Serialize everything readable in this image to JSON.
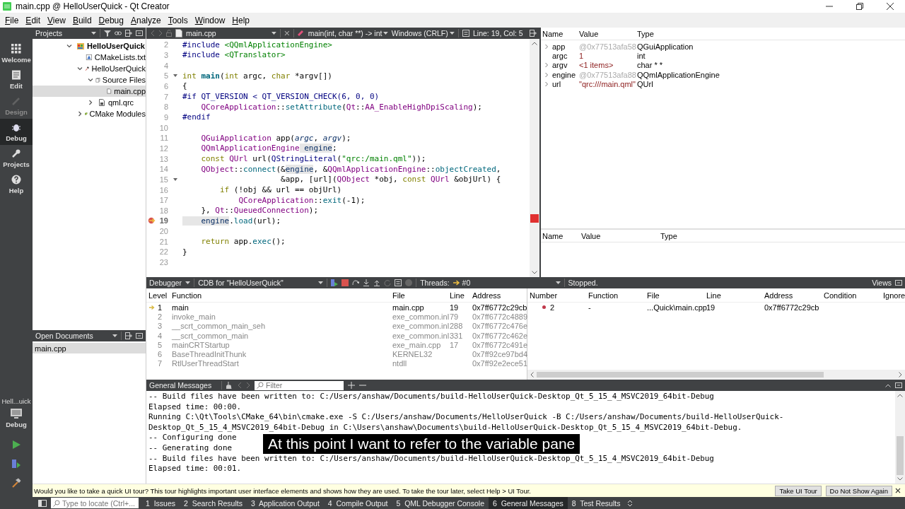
{
  "window": {
    "title": "main.cpp @ HelloUserQuick - Qt Creator"
  },
  "menu": [
    "File",
    "Edit",
    "View",
    "Build",
    "Debug",
    "Analyze",
    "Tools",
    "Window",
    "Help"
  ],
  "modes": [
    {
      "label": "Welcome",
      "selected": false,
      "disabled": false
    },
    {
      "label": "Edit",
      "selected": false,
      "disabled": false
    },
    {
      "label": "Design",
      "selected": false,
      "disabled": true
    },
    {
      "label": "Debug",
      "selected": true,
      "disabled": false
    },
    {
      "label": "Projects",
      "selected": false,
      "disabled": false
    },
    {
      "label": "Help",
      "selected": false,
      "disabled": false
    }
  ],
  "kit": {
    "project": "Hell...uick",
    "build": "Debug"
  },
  "projects": {
    "title": "Projects",
    "tree": [
      {
        "label": "HelloUserQuick",
        "kind": "project",
        "expanded": true,
        "selected": false,
        "children": [
          {
            "label": "CMakeLists.txt",
            "kind": "cmake",
            "selected": false
          },
          {
            "label": "HelloUserQuick",
            "kind": "target",
            "expanded": true,
            "selected": false,
            "children": [
              {
                "label": "Source Files",
                "kind": "folder",
                "expanded": true,
                "selected": false,
                "children": [
                  {
                    "label": "main.cpp",
                    "kind": "file",
                    "selected": true
                  }
                ]
              },
              {
                "label": "qml.qrc",
                "kind": "resource",
                "expanded": false,
                "selected": false
              }
            ]
          },
          {
            "label": "CMake Modules",
            "kind": "modules",
            "expanded": false,
            "selected": false
          }
        ]
      }
    ]
  },
  "open_documents": {
    "title": "Open Documents",
    "items": [
      {
        "label": "main.cpp",
        "selected": true
      }
    ]
  },
  "editor": {
    "file": "main.cpp",
    "symbol": "main(int, char **) -> int",
    "line_ending": "Windows (CRLF)",
    "position": "Line: 19, Col: 5",
    "lines": [
      {
        "n": "2",
        "tokens": [
          {
            "text": "#include ",
            "kind": "pp"
          },
          {
            "text": "<QQmlApplicationEngine>",
            "kind": "str"
          }
        ]
      },
      {
        "n": "3",
        "tokens": [
          {
            "text": "#include ",
            "kind": "pp"
          },
          {
            "text": "<QTranslator>",
            "kind": "str"
          }
        ]
      },
      {
        "n": "4"
      },
      {
        "n": "5",
        "fold": true,
        "tokens": [
          {
            "text": "int ",
            "kind": "kw"
          },
          {
            "text": "main",
            "kind": "fn"
          },
          {
            "text": "(",
            "kind": "plain"
          },
          {
            "text": "int",
            "kind": "kw"
          },
          {
            "text": " argc, ",
            "kind": "plain"
          },
          {
            "text": "char",
            "kind": "kw"
          },
          {
            "text": " *argv[])",
            "kind": "plain"
          }
        ]
      },
      {
        "n": "6",
        "tokens": [
          {
            "text": "{",
            "kind": "plain"
          }
        ]
      },
      {
        "n": "7",
        "tokens": [
          {
            "text": "#if QT_VERSION < QT_VERSION_CHECK(6, 0, 0)",
            "kind": "pp"
          }
        ]
      },
      {
        "n": "8",
        "tokens": [
          {
            "text": "    QCoreApplication",
            "kind": "type"
          },
          {
            "text": "::",
            "kind": "plain"
          },
          {
            "text": "setAttribute",
            "kind": "call"
          },
          {
            "text": "(",
            "kind": "plain"
          },
          {
            "text": "Qt",
            "kind": "type"
          },
          {
            "text": "::",
            "kind": "plain"
          },
          {
            "text": "AA_EnableHighDpiScaling",
            "kind": "enum"
          },
          {
            "text": ");",
            "kind": "plain"
          }
        ]
      },
      {
        "n": "9",
        "tokens": [
          {
            "text": "#endif",
            "kind": "pp"
          }
        ]
      },
      {
        "n": "10"
      },
      {
        "n": "11",
        "tokens": [
          {
            "text": "    QGuiApplication",
            "kind": "type"
          },
          {
            "text": " app(",
            "kind": "plain"
          },
          {
            "text": "argc",
            "kind": "param"
          },
          {
            "text": ", ",
            "kind": "plain"
          },
          {
            "text": "argv",
            "kind": "param"
          },
          {
            "text": ");",
            "kind": "plain"
          }
        ]
      },
      {
        "n": "12",
        "tokens": [
          {
            "text": "    QQmlApplicationEngine",
            "kind": "type"
          },
          {
            "text": " engine",
            "kind": "highlight"
          },
          {
            "text": ";",
            "kind": "plain"
          }
        ]
      },
      {
        "n": "13",
        "tokens": [
          {
            "text": "    const",
            "kind": "kw"
          },
          {
            "text": " QUrl",
            "kind": "type"
          },
          {
            "text": " url(",
            "kind": "plain"
          },
          {
            "text": "QStringLiteral",
            "kind": "pp"
          },
          {
            "text": "(",
            "kind": "plain"
          },
          {
            "text": "\"qrc:/main.qml\"",
            "kind": "str"
          },
          {
            "text": "));",
            "kind": "plain"
          }
        ]
      },
      {
        "n": "14",
        "tokens": [
          {
            "text": "    QObject",
            "kind": "type"
          },
          {
            "text": "::",
            "kind": "plain"
          },
          {
            "text": "connect",
            "kind": "call"
          },
          {
            "text": "(&",
            "kind": "plain"
          },
          {
            "text": "engine",
            "kind": "highlight"
          },
          {
            "text": ", &",
            "kind": "plain"
          },
          {
            "text": "QQmlApplicationEngine",
            "kind": "type"
          },
          {
            "text": "::",
            "kind": "plain"
          },
          {
            "text": "objectCreated",
            "kind": "call"
          },
          {
            "text": ",",
            "kind": "plain"
          }
        ]
      },
      {
        "n": "15",
        "fold": true,
        "tokens": [
          {
            "text": "                     &app, [url](",
            "kind": "plain"
          },
          {
            "text": "QObject",
            "kind": "type"
          },
          {
            "text": " *obj, ",
            "kind": "plain"
          },
          {
            "text": "const",
            "kind": "kw"
          },
          {
            "text": " QUrl",
            "kind": "type"
          },
          {
            "text": " &objUrl) {",
            "kind": "plain"
          }
        ]
      },
      {
        "n": "16",
        "tokens": [
          {
            "text": "        if",
            "kind": "kw"
          },
          {
            "text": " (!obj && url == objUrl)",
            "kind": "plain"
          }
        ]
      },
      {
        "n": "17",
        "tokens": [
          {
            "text": "            QCoreApplication",
            "kind": "type"
          },
          {
            "text": "::",
            "kind": "plain"
          },
          {
            "text": "exit",
            "kind": "call"
          },
          {
            "text": "(-1);",
            "kind": "plain"
          }
        ]
      },
      {
        "n": "18",
        "tokens": [
          {
            "text": "    }, ",
            "kind": "plain"
          },
          {
            "text": "Qt",
            "kind": "type"
          },
          {
            "text": "::",
            "kind": "plain"
          },
          {
            "text": "QueuedConnection",
            "kind": "enum"
          },
          {
            "text": ");",
            "kind": "plain"
          }
        ]
      },
      {
        "n": "19",
        "breakpoint": true,
        "current": true,
        "tokens": [
          {
            "text": "    engine",
            "kind": "highlight"
          },
          {
            "text": ".",
            "kind": "plain"
          },
          {
            "text": "load",
            "kind": "call"
          },
          {
            "text": "(url);",
            "kind": "plain"
          }
        ]
      },
      {
        "n": "20"
      },
      {
        "n": "21",
        "tokens": [
          {
            "text": "    return",
            "kind": "kw"
          },
          {
            "text": " app.",
            "kind": "plain"
          },
          {
            "text": "exec",
            "kind": "call"
          },
          {
            "text": "();",
            "kind": "plain"
          }
        ]
      },
      {
        "n": "22",
        "tokens": [
          {
            "text": "}",
            "kind": "plain"
          }
        ]
      },
      {
        "n": "23"
      }
    ]
  },
  "locals": {
    "columns": [
      "Name",
      "Value",
      "Type"
    ],
    "rows": [
      {
        "name": "app",
        "value": "@0x77513afa58",
        "type": "QGuiApplication",
        "expandable": true,
        "dim": true
      },
      {
        "name": "argc",
        "value": "1",
        "type": "int",
        "expandable": false,
        "dim": false
      },
      {
        "name": "argv",
        "value": "<1 items>",
        "type": "char * *",
        "expandable": true,
        "dim": false
      },
      {
        "name": "engine",
        "value": "@0x77513afa88",
        "type": "QQmlApplicationEngine",
        "expandable": true,
        "dim": true
      },
      {
        "name": "url",
        "value": "\"qrc:///main.qml\"",
        "type": "QUrl",
        "expandable": true,
        "dim": false
      }
    ]
  },
  "expressions": {
    "columns": [
      "Name",
      "Value",
      "Type"
    ]
  },
  "debugger_toolbar": {
    "view": "Debugger",
    "engine": "CDB for \"HelloUserQuick\"",
    "threads_label": "Threads:",
    "thread": "#0",
    "status": "Stopped.",
    "views": "Views"
  },
  "stack": {
    "columns": [
      "Level",
      "Function",
      "File",
      "Line",
      "Address"
    ],
    "rows": [
      {
        "level": "1",
        "function": "main",
        "file": "main.cpp",
        "line": "19",
        "address": "0x7ff6772c29cb",
        "current": true,
        "available": true
      },
      {
        "level": "2",
        "function": "invoke_main",
        "file": "exe_common.inl",
        "line": "79",
        "address": "0x7ff6772c4889",
        "current": false,
        "available": false
      },
      {
        "level": "3",
        "function": "__scrt_common_main_seh",
        "file": "exe_common.inl",
        "line": "288",
        "address": "0x7ff6772c476e",
        "current": false,
        "available": false
      },
      {
        "level": "4",
        "function": "__scrt_common_main",
        "file": "exe_common.inl",
        "line": "331",
        "address": "0x7ff6772c462e",
        "current": false,
        "available": false
      },
      {
        "level": "5",
        "function": "mainCRTStartup",
        "file": "exe_main.cpp",
        "line": "17",
        "address": "0x7ff6772c491e",
        "current": false,
        "available": false
      },
      {
        "level": "6",
        "function": "BaseThreadInitThunk",
        "file": "KERNEL32",
        "address": "0x7ff92ce97bd4",
        "current": false,
        "available": false
      },
      {
        "level": "7",
        "function": "RtlUserThreadStart",
        "file": "ntdll",
        "address": "0x7ff92e2ece51",
        "current": false,
        "available": false
      }
    ]
  },
  "breakpoints": {
    "columns": [
      "Number",
      "Function",
      "File",
      "Line",
      "Address",
      "Condition",
      "Ignore"
    ],
    "rows": [
      {
        "number": "2",
        "function": "-",
        "file": "...Quick\\main.cpp",
        "line": "19",
        "address": "0x7ff6772c29cb",
        "enabled": true
      }
    ]
  },
  "output": {
    "title": "General Messages",
    "filter_placeholder": "Filter",
    "lines": [
      "-- Build files have been written to: C:/Users/anshaw/Documents/build-HelloUserQuick-Desktop_Qt_5_15_4_MSVC2019_64bit-Debug",
      "Elapsed time: 00:00.",
      "Running C:\\Qt\\Tools\\CMake_64\\bin\\cmake.exe -S C:/Users/anshaw/Documents/HelloUserQuick -B C:/Users/anshaw/Documents/build-HelloUserQuick-",
      "Desktop_Qt_5_15_4_MSVC2019_64bit-Debug in C:\\Users\\anshaw\\Documents\\build-HelloUserQuick-Desktop_Qt_5_15_4_MSVC2019_64bit-Debug.",
      "-- Configuring done",
      "-- Generating done",
      "-- Build files have been written to: C:/Users/anshaw/Documents/build-HelloUserQuick-Desktop_Qt_5_15_4_MSVC2019_64bit-Debug",
      "Elapsed time: 00:01."
    ]
  },
  "caption": "At this point I want to refer to the variable pane",
  "tour": {
    "message": "Would you like to take a quick UI tour? This tour highlights important user interface elements and shows how they are used. To take the tour later, select Help > UI Tour.",
    "buttons": [
      "Take UI Tour",
      "Do Not Show Again"
    ]
  },
  "status_bar": {
    "locate_placeholder": "Type to locate (Ctrl+...",
    "tabs": [
      {
        "label": "1  Issues",
        "selected": false
      },
      {
        "label": "2  Search Results",
        "selected": false
      },
      {
        "label": "3  Application Output",
        "selected": false
      },
      {
        "label": "4  Compile Output",
        "selected": false
      },
      {
        "label": "5  QML Debugger Console",
        "selected": false
      },
      {
        "label": "6  General Messages",
        "selected": true
      },
      {
        "label": "8  Test Results",
        "selected": false
      }
    ]
  }
}
